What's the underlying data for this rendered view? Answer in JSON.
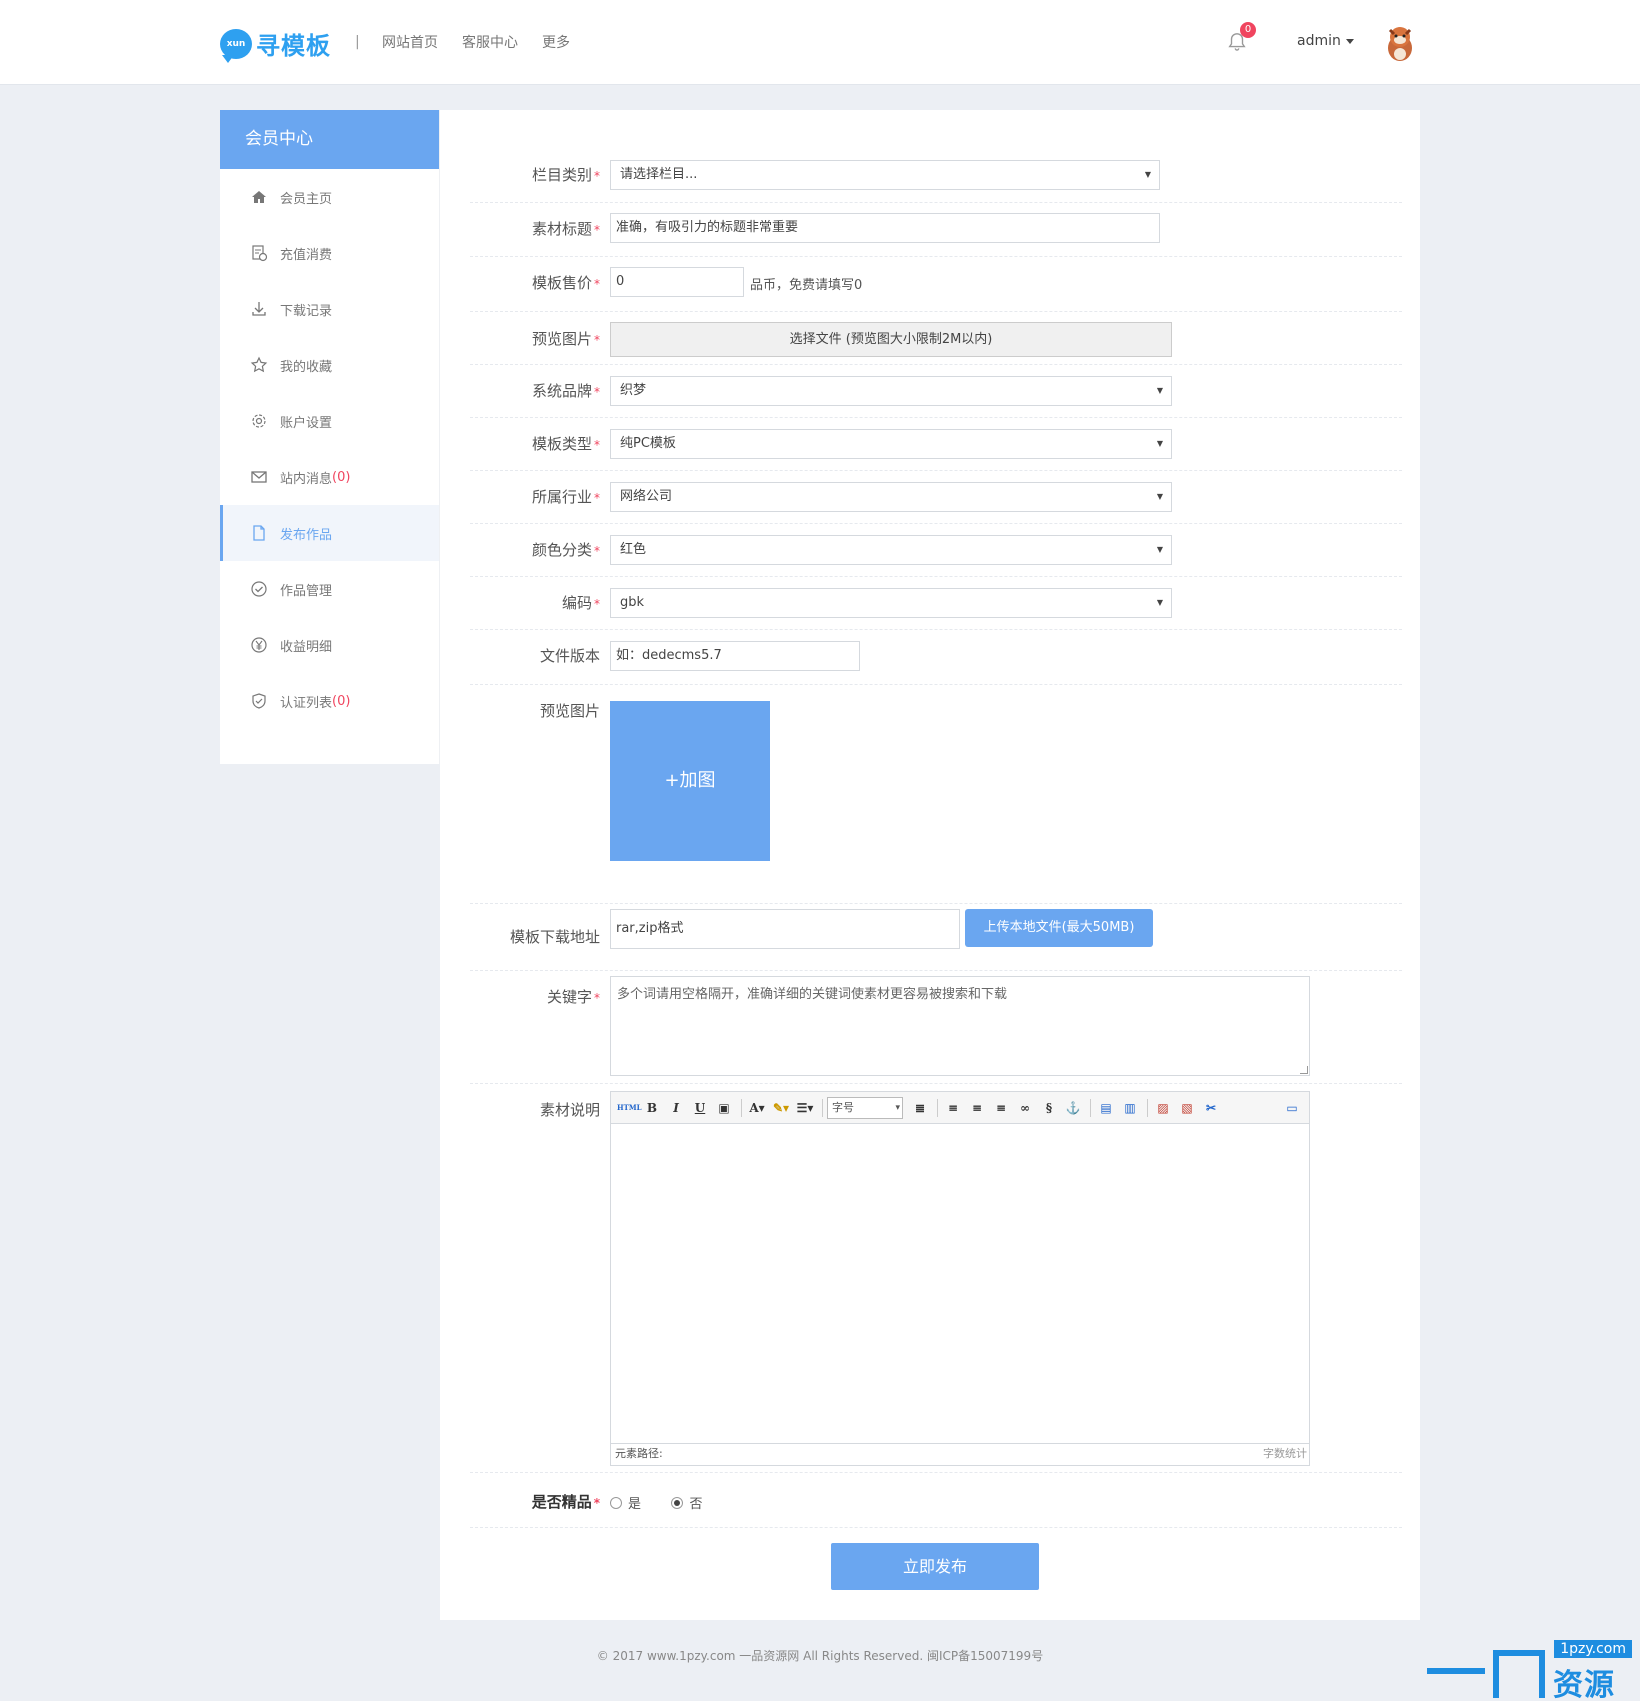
{
  "header": {
    "logo_badge": "xun",
    "logo_text": "寻模板",
    "separator": "|",
    "nav": [
      "网站首页",
      "客服中心",
      "更多"
    ],
    "notification_count": "0",
    "username": "admin"
  },
  "sidebar": {
    "title": "会员中心",
    "items": [
      {
        "label": "会员主页",
        "icon": "home-icon"
      },
      {
        "label": "充值消费",
        "icon": "recharge-icon"
      },
      {
        "label": "下载记录",
        "icon": "download-icon"
      },
      {
        "label": "我的收藏",
        "icon": "star-icon"
      },
      {
        "label": "账户设置",
        "icon": "gear-icon"
      },
      {
        "label": "站内消息",
        "icon": "mail-icon",
        "count": "(0)"
      },
      {
        "label": "发布作品",
        "icon": "document-icon",
        "active": true
      },
      {
        "label": "作品管理",
        "icon": "check-circle-icon"
      },
      {
        "label": "收益明细",
        "icon": "yen-icon"
      },
      {
        "label": "认证列表",
        "icon": "shield-icon",
        "count": "(0)"
      }
    ]
  },
  "form": {
    "required_mark": "*",
    "category": {
      "label": "栏目类别",
      "value": "请选择栏目..."
    },
    "title": {
      "label": "素材标题",
      "placeholder": "准确，有吸引力的标题非常重要"
    },
    "price": {
      "label": "模板售价",
      "value": "0",
      "hint": "品币，免费请填写0"
    },
    "preview_file": {
      "label": "预览图片",
      "button": "选择文件 (预览图大小限制2M以内)"
    },
    "brand": {
      "label": "系统品牌",
      "value": "织梦"
    },
    "template_type": {
      "label": "模板类型",
      "value": "纯PC模板"
    },
    "industry": {
      "label": "所属行业",
      "value": "网络公司"
    },
    "color": {
      "label": "颜色分类",
      "value": "红色"
    },
    "encoding": {
      "label": "编码",
      "value": "gbk"
    },
    "version": {
      "label": "文件版本",
      "placeholder": "如：dedecms5.7"
    },
    "preview_images": {
      "label": "预览图片",
      "button": "+加图"
    },
    "download": {
      "label": "模板下载地址",
      "placeholder": "rar,zip格式",
      "upload_button": "上传本地文件(最大50MB)"
    },
    "keywords": {
      "label": "关键字",
      "placeholder": "多个词请用空格隔开，准确详细的关键词使素材更容易被搜索和下载"
    },
    "description": {
      "label": "素材说明",
      "font_size_placeholder": "字号",
      "status_path": "元素路径:",
      "status_count": "字数统计"
    },
    "featured": {
      "label": "是否精品",
      "options": [
        "是",
        "否"
      ],
      "selected": "否"
    },
    "submit": "立即发布"
  },
  "footer": {
    "text": "© 2017 www.1pzy.com 一品资源网 All Rights Reserved. 闽ICP备15007199号"
  },
  "watermark": {
    "url": "1pzy.com",
    "text": "资源网"
  },
  "colors": {
    "accent": "#6aa6f0",
    "logo": "#2ea0f0",
    "required": "#f0455f",
    "background": "#eceff4"
  }
}
